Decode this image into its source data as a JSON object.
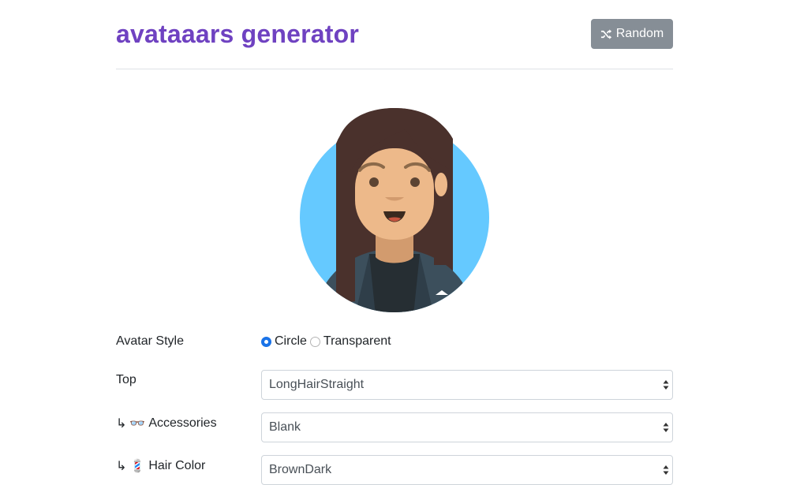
{
  "header": {
    "title": "avataaars generator",
    "random_button": {
      "label": "Random",
      "icon": "shuffle-icon"
    }
  },
  "avatar": {
    "style": "Circle",
    "background_color": "#65c9ff",
    "skin_color": "#edb98a",
    "hair_color": "#4a312c",
    "clothes_color": "#3c4f5c"
  },
  "form": {
    "avatar_style": {
      "label": "Avatar Style",
      "options": [
        "Circle",
        "Transparent"
      ],
      "selected": "Circle"
    },
    "top": {
      "label": "Top",
      "value": "LongHairStraight"
    },
    "accessories": {
      "prefix": "↳",
      "emoji": "👓",
      "label": "Accessories",
      "value": "Blank"
    },
    "hair_color": {
      "prefix": "↳",
      "emoji": "💈",
      "label": "Hair Color",
      "value": "BrownDark"
    }
  }
}
